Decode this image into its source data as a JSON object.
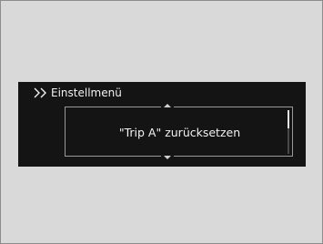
{
  "menu": {
    "title": "Einstellmenü",
    "title_icon": "double-chevron-right-icon"
  },
  "selected_item": {
    "label": "\"Trip A\" zurücksetzen"
  },
  "navigation": {
    "up_icon": "arrow-up-icon",
    "down_icon": "arrow-down-icon"
  },
  "scroll": {
    "position_fraction": 0.0
  },
  "colors": {
    "background": "#d9d9d9",
    "display": "#141414",
    "text": "#f2f2f2"
  }
}
